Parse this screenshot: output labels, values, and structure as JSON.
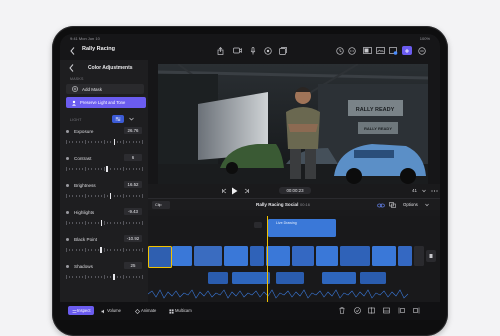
{
  "status": {
    "time": "9:41  Mon Jun 10",
    "battery": "100%"
  },
  "header": {
    "project_title": "Rally Racing"
  },
  "panel": {
    "title": "Color Adjustments",
    "masks_label": "MASKS",
    "add_mask_label": "Add Mask",
    "skin_button_label": "Preserve Light and Tone",
    "light_label": "LIGHT",
    "adjustments": [
      {
        "name": "Exposure",
        "value": "26.76",
        "level": 0.63
      },
      {
        "name": "Contrast",
        "value": "6",
        "level": 0.53
      },
      {
        "name": "Brightness",
        "value": "16.52",
        "level": 0.58
      },
      {
        "name": "Highlights",
        "value": "-9.43",
        "level": 0.46
      },
      {
        "name": "Black Point",
        "value": "-10.92",
        "level": 0.45
      },
      {
        "name": "Shadows",
        "value": "25",
        "level": 0.62
      }
    ]
  },
  "viewer": {
    "timecode": "00:00:23",
    "zoom": "41",
    "wall_sign_1": "RALLY READY",
    "wall_sign_2": "RALLY READY"
  },
  "timeline": {
    "clip_badge": "Clip",
    "title": "Rally Racing Social",
    "duration": "00:16",
    "options_label": "Options",
    "title_clip_label": "Live Drawing"
  },
  "bottom": {
    "tabs": [
      "Inspect",
      "Volume",
      "Animate",
      "Multicam"
    ]
  },
  "colors": {
    "accent": "#6b5cf0",
    "clip_blue": "#3a78d8",
    "selected_yellow": "#f2c200"
  }
}
